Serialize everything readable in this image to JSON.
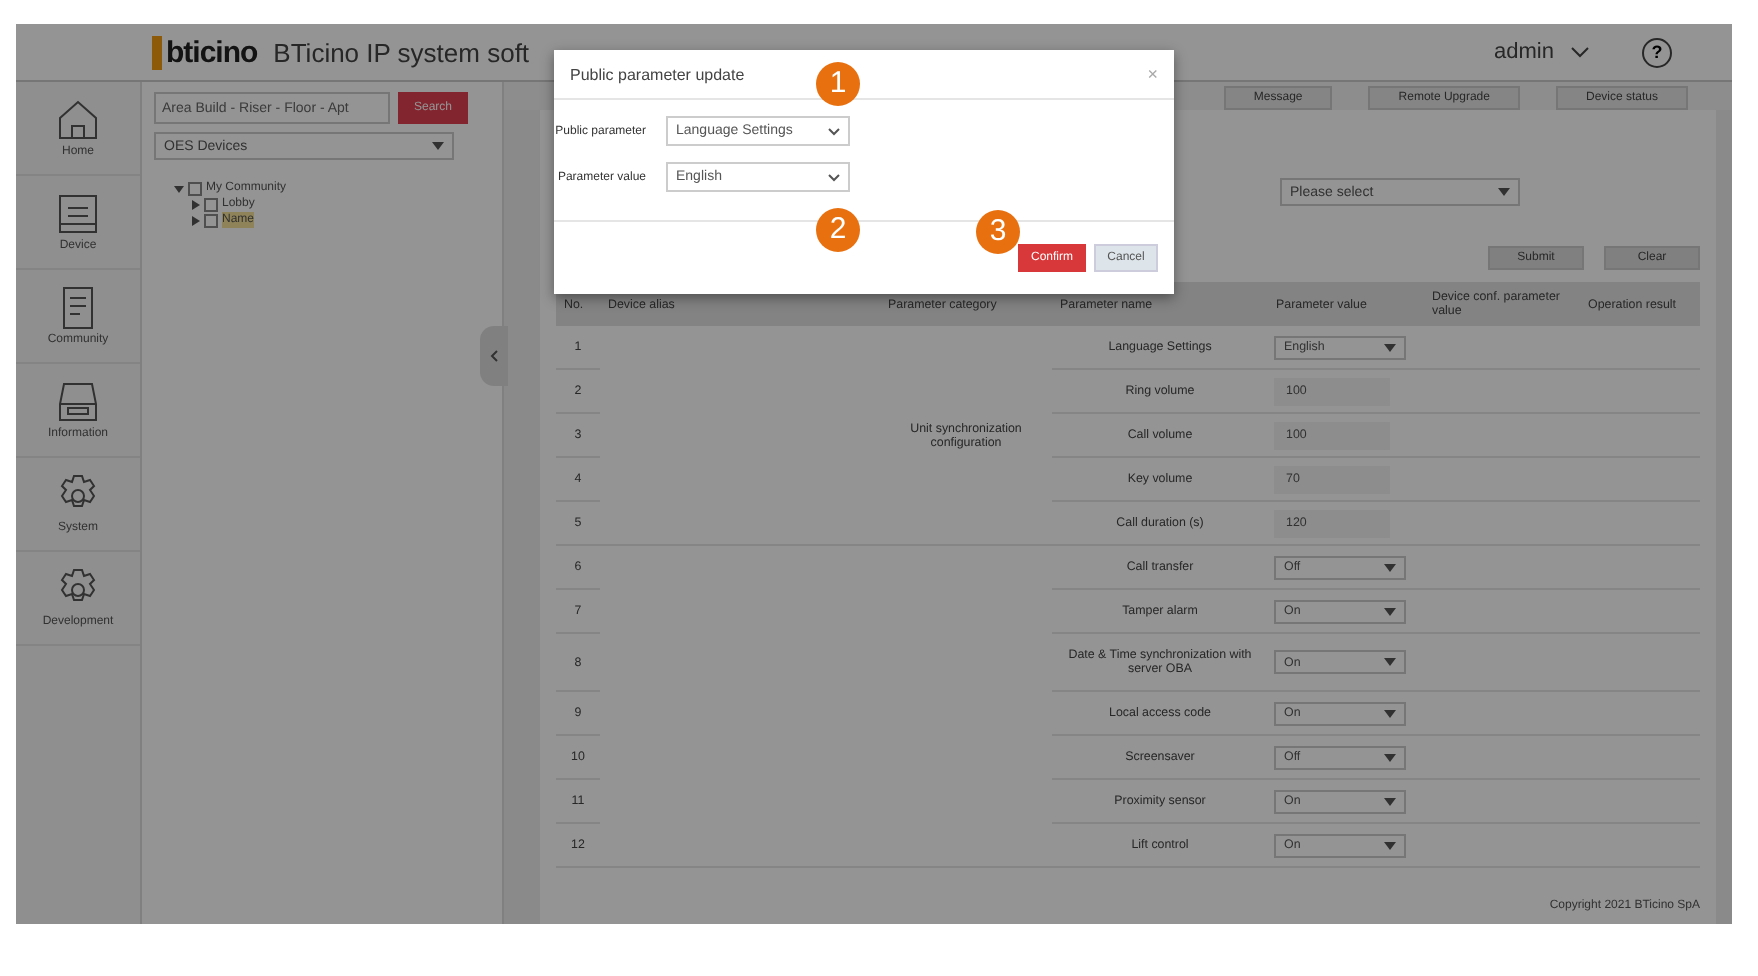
{
  "header": {
    "logo": "bticino",
    "title": "BTicino IP system soft",
    "user": "admin",
    "help": "?"
  },
  "toolbar": [
    "Message",
    "Remote Upgrade",
    "Device status"
  ],
  "sidebar": {
    "items": [
      {
        "label": "Home",
        "selected": false
      },
      {
        "label": "Device",
        "selected": false
      },
      {
        "label": "Community",
        "selected": false
      },
      {
        "label": "Information",
        "selected": false
      },
      {
        "label": "System",
        "selected": false
      },
      {
        "label": "Development",
        "selected": false
      }
    ]
  },
  "tree_panel": {
    "search": {
      "placeholder": "Area Build - Riser - Floor - Apt"
    },
    "search_button": "Search",
    "device_select": "OES Devices",
    "tree": [
      {
        "label": "My Community",
        "expanded": true,
        "checked": false,
        "children": [
          {
            "label": "Lobby",
            "selected": false,
            "checked": false
          },
          {
            "label": "Name",
            "selected": true,
            "checked": false
          }
        ]
      }
    ]
  },
  "filter": {
    "select": "Please select",
    "buttons": [
      "Submit",
      "Clear"
    ]
  },
  "table": {
    "columns": [
      "No.",
      "Device alias",
      "Parameter category",
      "Parameter name",
      "Parameter value",
      "Device conf. parameter value",
      "Operation result"
    ],
    "groups": [
      {
        "category": "Unit synchronization configuration",
        "rows": [
          {
            "no": "1",
            "name": "Language Settings",
            "kind": "select",
            "value": "English"
          },
          {
            "no": "2",
            "name": "Ring volume",
            "kind": "input",
            "value": "100"
          },
          {
            "no": "3",
            "name": "Call volume",
            "kind": "input",
            "value": "100"
          },
          {
            "no": "4",
            "name": "Key volume",
            "kind": "input",
            "value": "70"
          },
          {
            "no": "5",
            "name": "Call duration (s)",
            "kind": "input",
            "value": "120"
          }
        ]
      },
      {
        "rows": [
          {
            "no": "6",
            "name": "Call transfer",
            "kind": "select",
            "value": "Off"
          },
          {
            "no": "7",
            "name": "Tamper alarm",
            "kind": "select",
            "value": "On"
          },
          {
            "no": "8",
            "name": "Date & Time synchronization with server OBA",
            "kind": "select",
            "value": "On"
          },
          {
            "no": "9",
            "name": "Local access code",
            "kind": "select",
            "value": "On"
          },
          {
            "no": "10",
            "name": "Screensaver",
            "kind": "select",
            "value": "Off"
          },
          {
            "no": "11",
            "name": "Proximity sensor",
            "kind": "select",
            "value": "On"
          },
          {
            "no": "12",
            "name": "Lift control",
            "kind": "select",
            "value": "On"
          }
        ]
      }
    ]
  },
  "footer": "Copyright 2021 BTicino SpA",
  "dialog": {
    "title": "Public parameter update",
    "close": "×",
    "fields": [
      {
        "label": "Public parameter",
        "kind": "select",
        "value": "Language Settings"
      },
      {
        "label": "Parameter value",
        "kind": "select",
        "value": "English"
      }
    ],
    "buttons": [
      {
        "label": "Confirm",
        "kind": "primary"
      },
      {
        "label": "Cancel",
        "kind": "secondary"
      }
    ]
  },
  "callouts": [
    "1",
    "2",
    "3"
  ]
}
